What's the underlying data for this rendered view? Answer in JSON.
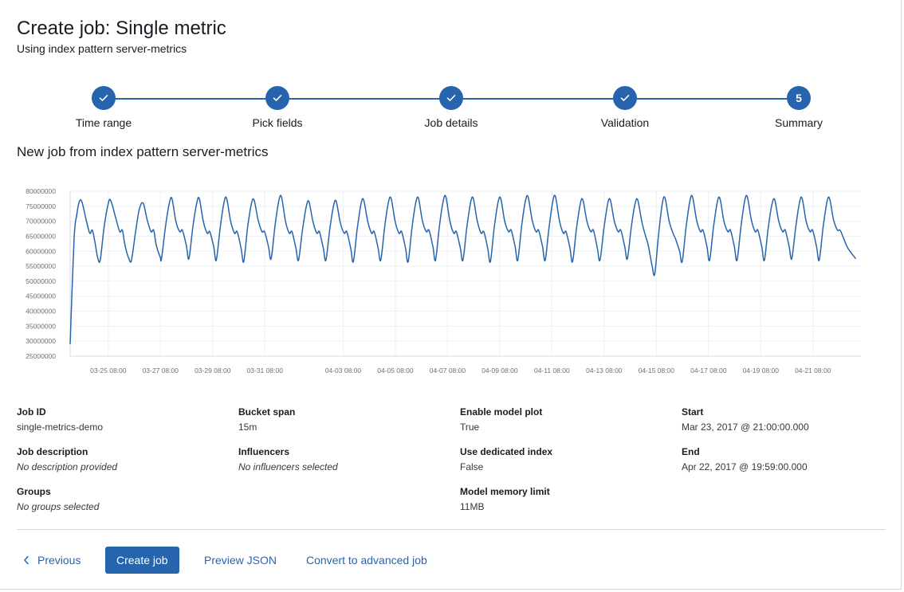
{
  "page": {
    "title": "Create job: Single metric",
    "subtitle": "Using index pattern server-metrics"
  },
  "steps": [
    {
      "label": "Time range",
      "state": "complete"
    },
    {
      "label": "Pick fields",
      "state": "complete"
    },
    {
      "label": "Job details",
      "state": "complete"
    },
    {
      "label": "Validation",
      "state": "complete"
    },
    {
      "label": "Summary",
      "state": "current",
      "number": "5"
    }
  ],
  "chart_title": "New job from index pattern server-metrics",
  "chart_data": {
    "type": "line",
    "title": "",
    "xlabel": "",
    "ylabel": "",
    "ylim": [
      25000000,
      80000000
    ],
    "y_ticks": [
      "80000000",
      "75000000",
      "70000000",
      "65000000",
      "60000000",
      "55000000",
      "50000000",
      "45000000",
      "40000000",
      "35000000",
      "30000000",
      "25000000"
    ],
    "x_range_days": [
      0,
      30.3
    ],
    "x_ticks": [
      {
        "label": "03-25 08:00",
        "day": 1.46
      },
      {
        "label": "03-27 08:00",
        "day": 3.46
      },
      {
        "label": "03-29 08:00",
        "day": 5.46
      },
      {
        "label": "03-31 08:00",
        "day": 7.46
      },
      {
        "label": "04-03 08:00",
        "day": 10.46
      },
      {
        "label": "04-05 08:00",
        "day": 12.46
      },
      {
        "label": "04-07 08:00",
        "day": 14.46
      },
      {
        "label": "04-09 08:00",
        "day": 16.46
      },
      {
        "label": "04-11 08:00",
        "day": 18.46
      },
      {
        "label": "04-13 08:00",
        "day": 20.46
      },
      {
        "label": "04-15 08:00",
        "day": 22.46
      },
      {
        "label": "04-17 08:00",
        "day": 24.46
      },
      {
        "label": "04-19 08:00",
        "day": 26.46
      },
      {
        "label": "04-21 08:00",
        "day": 28.46
      }
    ],
    "series": [
      {
        "color": "#2665ad",
        "points": [
          [
            0.0,
            29000000
          ],
          [
            0.15,
            64000000
          ],
          [
            0.25,
            72000000
          ],
          [
            0.35,
            76500000
          ],
          [
            0.45,
            76500000
          ],
          [
            0.6,
            71000000
          ],
          [
            0.75,
            66000000
          ],
          [
            0.85,
            67000000
          ],
          [
            0.95,
            63000000
          ],
          [
            1.05,
            58000000
          ],
          [
            1.15,
            57000000
          ],
          [
            1.3,
            68000000
          ],
          [
            1.45,
            75500000
          ],
          [
            1.55,
            77000000
          ],
          [
            1.75,
            71000000
          ],
          [
            1.9,
            66500000
          ],
          [
            2.0,
            67000000
          ],
          [
            2.1,
            62000000
          ],
          [
            2.25,
            57500000
          ],
          [
            2.35,
            57000000
          ],
          [
            2.5,
            66000000
          ],
          [
            2.65,
            74000000
          ],
          [
            2.8,
            76000000
          ],
          [
            2.95,
            70500000
          ],
          [
            3.1,
            66500000
          ],
          [
            3.2,
            67000000
          ],
          [
            3.3,
            62000000
          ],
          [
            3.45,
            58000000
          ],
          [
            3.5,
            57500000
          ],
          [
            3.65,
            68000000
          ],
          [
            3.8,
            76000000
          ],
          [
            3.9,
            77500000
          ],
          [
            4.05,
            70000000
          ],
          [
            4.2,
            66500000
          ],
          [
            4.3,
            67000000
          ],
          [
            4.45,
            62000000
          ],
          [
            4.55,
            57500000
          ],
          [
            4.7,
            68000000
          ],
          [
            4.85,
            76000000
          ],
          [
            4.95,
            77500000
          ],
          [
            5.1,
            70000000
          ],
          [
            5.25,
            66000000
          ],
          [
            5.35,
            66500000
          ],
          [
            5.5,
            61500000
          ],
          [
            5.6,
            57000000
          ],
          [
            5.75,
            68000000
          ],
          [
            5.9,
            76500000
          ],
          [
            6.0,
            77500000
          ],
          [
            6.15,
            70000000
          ],
          [
            6.3,
            66000000
          ],
          [
            6.4,
            66500000
          ],
          [
            6.55,
            61000000
          ],
          [
            6.65,
            56500000
          ],
          [
            6.8,
            68000000
          ],
          [
            6.95,
            76000000
          ],
          [
            7.05,
            77000000
          ],
          [
            7.2,
            70500000
          ],
          [
            7.35,
            66500000
          ],
          [
            7.45,
            66500000
          ],
          [
            7.6,
            61500000
          ],
          [
            7.7,
            57500000
          ],
          [
            7.85,
            68500000
          ],
          [
            8.0,
            77000000
          ],
          [
            8.1,
            78000000
          ],
          [
            8.25,
            70000000
          ],
          [
            8.4,
            66000000
          ],
          [
            8.5,
            66500000
          ],
          [
            8.65,
            61000000
          ],
          [
            8.75,
            57000000
          ],
          [
            8.9,
            67000000
          ],
          [
            9.05,
            75000000
          ],
          [
            9.15,
            76500000
          ],
          [
            9.3,
            70000000
          ],
          [
            9.45,
            66000000
          ],
          [
            9.55,
            66500000
          ],
          [
            9.7,
            61000000
          ],
          [
            9.8,
            57000000
          ],
          [
            9.95,
            67500000
          ],
          [
            10.1,
            75500000
          ],
          [
            10.2,
            76500000
          ],
          [
            10.35,
            69500000
          ],
          [
            10.5,
            66000000
          ],
          [
            10.6,
            66500000
          ],
          [
            10.75,
            61000000
          ],
          [
            10.85,
            56500000
          ],
          [
            11.0,
            67500000
          ],
          [
            11.15,
            76000000
          ],
          [
            11.25,
            77000000
          ],
          [
            11.4,
            70000000
          ],
          [
            11.55,
            66000000
          ],
          [
            11.65,
            66500000
          ],
          [
            11.8,
            61000000
          ],
          [
            11.9,
            57000000
          ],
          [
            12.05,
            68000000
          ],
          [
            12.2,
            76500000
          ],
          [
            12.3,
            77500000
          ],
          [
            12.45,
            70000000
          ],
          [
            12.6,
            66000000
          ],
          [
            12.7,
            66500000
          ],
          [
            12.85,
            61000000
          ],
          [
            12.95,
            56500000
          ],
          [
            13.1,
            68000000
          ],
          [
            13.25,
            76500000
          ],
          [
            13.35,
            77500000
          ],
          [
            13.5,
            70000000
          ],
          [
            13.65,
            66500000
          ],
          [
            13.75,
            67000000
          ],
          [
            13.9,
            61500000
          ],
          [
            14.0,
            57000000
          ],
          [
            14.15,
            68500000
          ],
          [
            14.3,
            77000000
          ],
          [
            14.4,
            78000000
          ],
          [
            14.55,
            70000000
          ],
          [
            14.7,
            66000000
          ],
          [
            14.8,
            66500000
          ],
          [
            14.95,
            61000000
          ],
          [
            15.05,
            57000000
          ],
          [
            15.2,
            68000000
          ],
          [
            15.35,
            76500000
          ],
          [
            15.45,
            77500000
          ],
          [
            15.6,
            70000000
          ],
          [
            15.75,
            66000000
          ],
          [
            15.85,
            66500000
          ],
          [
            16.0,
            61000000
          ],
          [
            16.1,
            56500000
          ],
          [
            16.25,
            68000000
          ],
          [
            16.4,
            76500000
          ],
          [
            16.5,
            77500000
          ],
          [
            16.65,
            70000000
          ],
          [
            16.8,
            66500000
          ],
          [
            16.9,
            67000000
          ],
          [
            17.05,
            61500000
          ],
          [
            17.15,
            57000000
          ],
          [
            17.3,
            68500000
          ],
          [
            17.45,
            77000000
          ],
          [
            17.55,
            78000000
          ],
          [
            17.7,
            70500000
          ],
          [
            17.85,
            66500000
          ],
          [
            17.95,
            67000000
          ],
          [
            18.1,
            61500000
          ],
          [
            18.2,
            57000000
          ],
          [
            18.35,
            68000000
          ],
          [
            18.5,
            77000000
          ],
          [
            18.6,
            78000000
          ],
          [
            18.75,
            70000000
          ],
          [
            18.9,
            66000000
          ],
          [
            19.0,
            66500000
          ],
          [
            19.15,
            61000000
          ],
          [
            19.25,
            56500000
          ],
          [
            19.4,
            67500000
          ],
          [
            19.55,
            76000000
          ],
          [
            19.65,
            77000000
          ],
          [
            19.8,
            70000000
          ],
          [
            19.95,
            66500000
          ],
          [
            20.05,
            67000000
          ],
          [
            20.2,
            61000000
          ],
          [
            20.3,
            57000000
          ],
          [
            20.45,
            67500000
          ],
          [
            20.6,
            76000000
          ],
          [
            20.7,
            77000000
          ],
          [
            20.85,
            70000000
          ],
          [
            21.0,
            66500000
          ],
          [
            21.1,
            67000000
          ],
          [
            21.25,
            61500000
          ],
          [
            21.35,
            57500000
          ],
          [
            21.5,
            68000000
          ],
          [
            21.65,
            76000000
          ],
          [
            21.75,
            77000000
          ],
          [
            21.9,
            70000000
          ],
          [
            22.05,
            65000000
          ],
          [
            22.15,
            62000000
          ],
          [
            22.3,
            55000000
          ],
          [
            22.4,
            52500000
          ],
          [
            22.55,
            66000000
          ],
          [
            22.7,
            76500000
          ],
          [
            22.8,
            77500000
          ],
          [
            22.95,
            70000000
          ],
          [
            23.1,
            66000000
          ],
          [
            23.2,
            64000000
          ],
          [
            23.35,
            60000000
          ],
          [
            23.45,
            56500000
          ],
          [
            23.6,
            68000000
          ],
          [
            23.75,
            77000000
          ],
          [
            23.85,
            78000000
          ],
          [
            24.0,
            70500000
          ],
          [
            24.15,
            66500000
          ],
          [
            24.25,
            67000000
          ],
          [
            24.4,
            61500000
          ],
          [
            24.5,
            57000000
          ],
          [
            24.65,
            68000000
          ],
          [
            24.8,
            76500000
          ],
          [
            24.9,
            77500000
          ],
          [
            25.05,
            70000000
          ],
          [
            25.2,
            66500000
          ],
          [
            25.3,
            67000000
          ],
          [
            25.45,
            61500000
          ],
          [
            25.55,
            57000000
          ],
          [
            25.7,
            68000000
          ],
          [
            25.85,
            77000000
          ],
          [
            25.95,
            78000000
          ],
          [
            26.1,
            70500000
          ],
          [
            26.25,
            66500000
          ],
          [
            26.35,
            67000000
          ],
          [
            26.5,
            61500000
          ],
          [
            26.6,
            57000000
          ],
          [
            26.75,
            68000000
          ],
          [
            26.9,
            76000000
          ],
          [
            27.0,
            77000000
          ],
          [
            27.15,
            70000000
          ],
          [
            27.3,
            66500000
          ],
          [
            27.4,
            67000000
          ],
          [
            27.55,
            61500000
          ],
          [
            27.65,
            57500000
          ],
          [
            27.8,
            68000000
          ],
          [
            27.95,
            76500000
          ],
          [
            28.05,
            77500000
          ],
          [
            28.2,
            70000000
          ],
          [
            28.35,
            66500000
          ],
          [
            28.45,
            67000000
          ],
          [
            28.6,
            61500000
          ],
          [
            28.7,
            57000000
          ],
          [
            28.85,
            68000000
          ],
          [
            29.0,
            76500000
          ],
          [
            29.1,
            77500000
          ],
          [
            29.25,
            70500000
          ],
          [
            29.4,
            67000000
          ],
          [
            29.5,
            67000000
          ],
          [
            29.65,
            64000000
          ],
          [
            29.8,
            61000000
          ],
          [
            30.1,
            57500000
          ]
        ]
      }
    ],
    "grid": "x-and-y",
    "legend": "none"
  },
  "details": {
    "columns": [
      [
        {
          "label": "Job ID",
          "value": "single-metrics-demo",
          "empty": false
        },
        {
          "label": "Job description",
          "value": "No description provided",
          "empty": true
        },
        {
          "label": "Groups",
          "value": "No groups selected",
          "empty": true
        }
      ],
      [
        {
          "label": "Bucket span",
          "value": "15m",
          "empty": false
        },
        {
          "label": "Influencers",
          "value": "No influencers selected",
          "empty": true
        }
      ],
      [
        {
          "label": "Enable model plot",
          "value": "True",
          "empty": false
        },
        {
          "label": "Use dedicated index",
          "value": "False",
          "empty": false
        },
        {
          "label": "Model memory limit",
          "value": "11MB",
          "empty": false
        }
      ],
      [
        {
          "label": "Start",
          "value": "Mar 23, 2017 @ 21:00:00.000",
          "empty": false
        },
        {
          "label": "End",
          "value": "Apr 22, 2017 @ 19:59:00.000",
          "empty": false
        }
      ]
    ]
  },
  "footer": {
    "previous_label": "Previous",
    "create_label": "Create job",
    "preview_label": "Preview JSON",
    "convert_label": "Convert to advanced job"
  },
  "colors": {
    "accent": "#2665ad",
    "border": "#d3dae6",
    "text": "#1a1c21"
  }
}
